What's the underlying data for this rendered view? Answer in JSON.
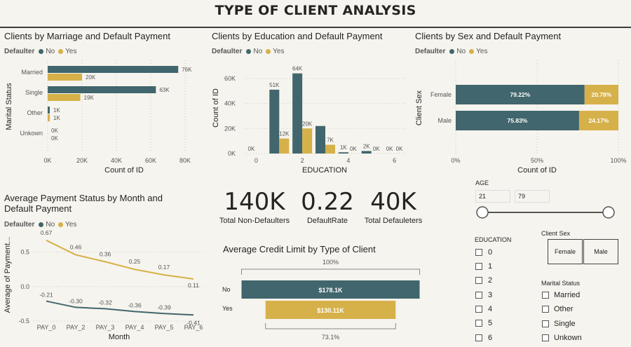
{
  "title": "TYPE OF CLIENT ANALYSIS",
  "colors": {
    "no": "#41666d",
    "yes": "#d6b14a"
  },
  "legend": {
    "title": "Defaulter",
    "no": "No",
    "yes": "Yes"
  },
  "chart_data": [
    {
      "id": "marriage",
      "type": "bar",
      "orientation": "horizontal",
      "title": "Clients by Marriage and Default Payment",
      "xlabel": "Count of ID",
      "ylabel": "Marital Status",
      "categories": [
        "Married",
        "Single",
        "Other",
        "Unkown"
      ],
      "series": [
        {
          "name": "No",
          "values": [
            76000,
            63000,
            1000,
            0
          ],
          "labels": [
            "76K",
            "63K",
            "1K",
            "0K"
          ]
        },
        {
          "name": "Yes",
          "values": [
            20000,
            19000,
            1000,
            0
          ],
          "labels": [
            "20K",
            "19K",
            "1K",
            "0K"
          ]
        }
      ],
      "xlim": [
        0,
        80000
      ],
      "xticks": [
        "0K",
        "20K",
        "40K",
        "60K",
        "80K"
      ]
    },
    {
      "id": "education",
      "type": "bar",
      "title": "Clients by Education and Default Payment",
      "xlabel": "EDUCATION",
      "ylabel": "Count of ID",
      "categories": [
        "0",
        "1",
        "2",
        "3",
        "4",
        "5",
        "6"
      ],
      "series": [
        {
          "name": "No",
          "values": [
            0,
            51000,
            64000,
            22000,
            1000,
            2000,
            0
          ],
          "labels": [
            "0K",
            "51K",
            "64K",
            "",
            "1K",
            "2K",
            "0K"
          ]
        },
        {
          "name": "Yes",
          "values": [
            0,
            12000,
            20000,
            7000,
            0,
            0,
            0
          ],
          "labels": [
            "",
            "12K",
            "20K",
            "7K",
            "0K",
            "0K",
            "0K"
          ]
        }
      ],
      "ylim": [
        0,
        70000
      ],
      "yticks": [
        "0K",
        "20K",
        "40K",
        "60K"
      ],
      "xticks": [
        "0",
        "2",
        "4",
        "6"
      ]
    },
    {
      "id": "sex",
      "type": "bar",
      "orientation": "horizontal",
      "stacked": "100%",
      "title": "Clients by Sex and Default Payment",
      "xlabel": "Count of ID",
      "ylabel": "Client Sex",
      "categories": [
        "Female",
        "Male"
      ],
      "series": [
        {
          "name": "No",
          "values": [
            79.22,
            75.83
          ],
          "labels": [
            "79.22%",
            "75.83%"
          ]
        },
        {
          "name": "Yes",
          "values": [
            20.78,
            24.17
          ],
          "labels": [
            "20.78%",
            "24.17%"
          ]
        }
      ],
      "xticks": [
        "0%",
        "50%",
        "100%"
      ]
    },
    {
      "id": "payment",
      "type": "line",
      "title": "Average Payment Status by Month and Default Payment",
      "title_lines": [
        "Average Payment Status by Month and",
        "Default Payment"
      ],
      "xlabel": "Month",
      "ylabel": "Average of Payment...",
      "categories": [
        "PAY_0",
        "PAY_2",
        "PAY_3",
        "PAY_4",
        "PAY_5",
        "PAY_6"
      ],
      "series": [
        {
          "name": "Yes",
          "values": [
            0.67,
            0.46,
            0.36,
            0.25,
            0.17,
            0.11
          ],
          "labels": [
            "0.67",
            "0.46",
            "0.36",
            "0.25",
            "0.17",
            "0.11"
          ]
        },
        {
          "name": "No",
          "values": [
            -0.21,
            -0.3,
            -0.32,
            -0.36,
            -0.39,
            -0.41
          ],
          "labels": [
            "-0.21",
            "-0.30",
            "-0.32",
            "-0.36",
            "-0.39",
            "-0.41"
          ]
        }
      ],
      "ylim": [
        -0.6,
        0.8
      ],
      "yticks": [
        "0.5",
        "0.0",
        "-0.5"
      ]
    },
    {
      "id": "credit",
      "type": "funnel",
      "title": "Average Credit Limit by Type of Client",
      "categories": [
        "No",
        "Yes"
      ],
      "values": [
        178100,
        130110
      ],
      "labels": [
        "$178.1K",
        "$130.11K"
      ],
      "top_pct": "100%",
      "bottom_pct": "73.1%"
    }
  ],
  "cards": [
    {
      "value": "140K",
      "label": "Total Non-Defaulters"
    },
    {
      "value": "0.22",
      "label": "DefaultRate"
    },
    {
      "value": "40K",
      "label": "Total Defauleters"
    }
  ],
  "slicers": {
    "age": {
      "title": "AGE",
      "min": "21",
      "max": "79"
    },
    "education": {
      "title": "EDUCATION",
      "options": [
        "0",
        "1",
        "2",
        "3",
        "4",
        "5",
        "6"
      ]
    },
    "sex": {
      "title": "Client Sex",
      "options": [
        "Female",
        "Male"
      ]
    },
    "marital": {
      "title": "Marital Status",
      "options": [
        "Married",
        "Other",
        "Single",
        "Unkown"
      ]
    }
  }
}
